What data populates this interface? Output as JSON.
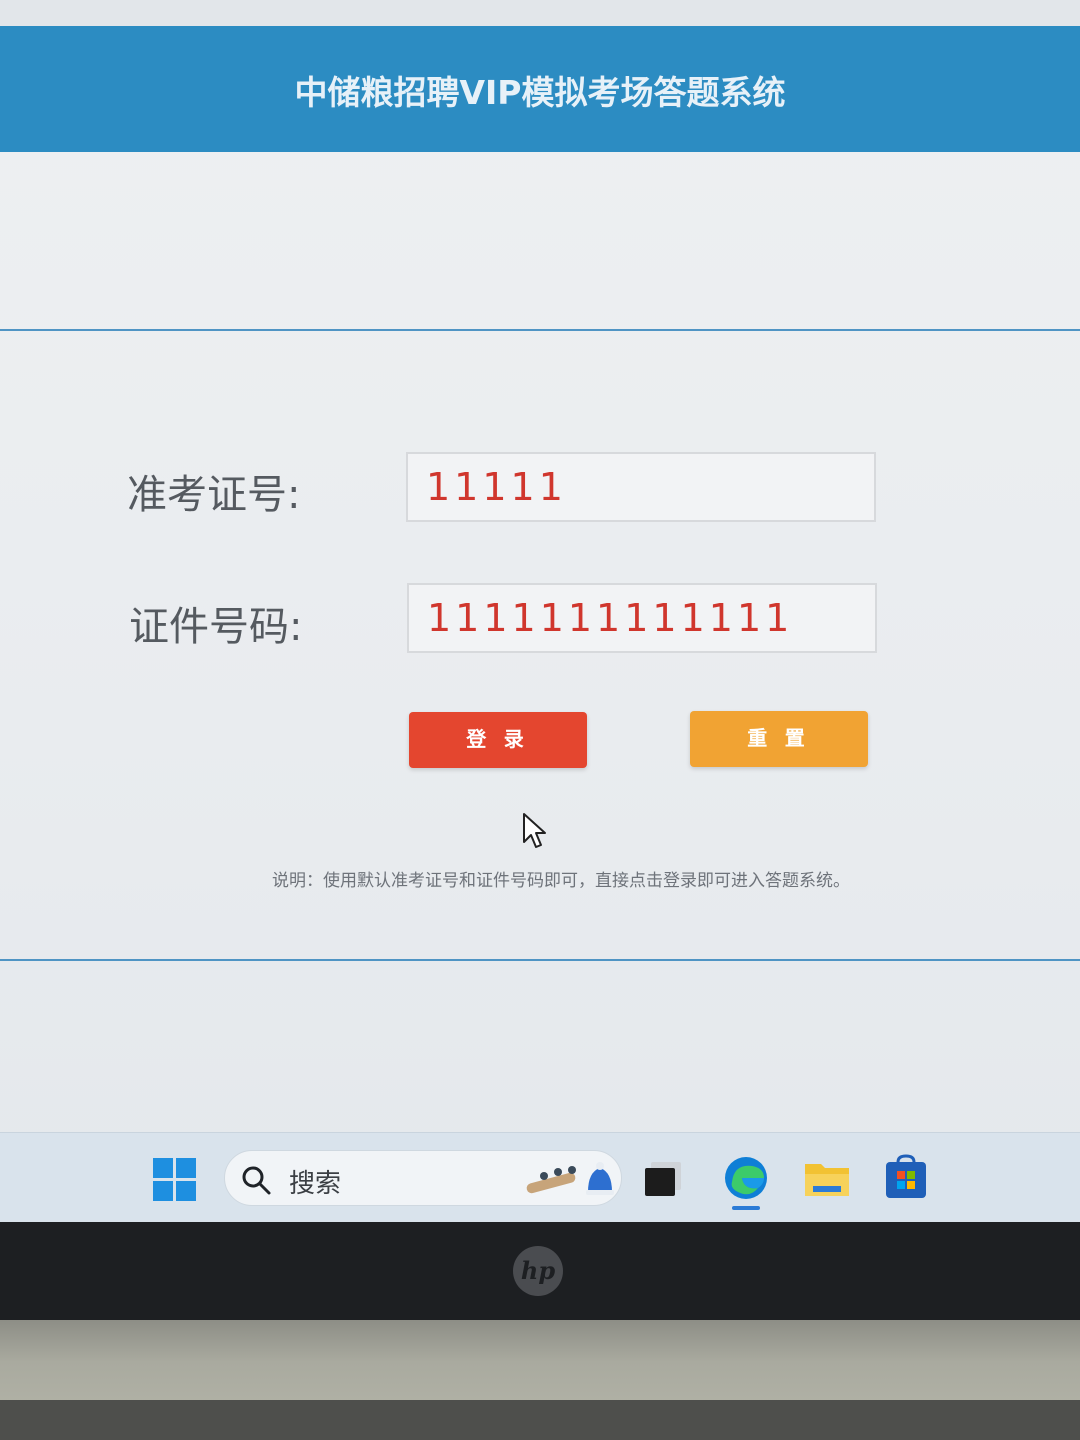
{
  "header": {
    "title": "中储粮招聘VIP模拟考场答题系统"
  },
  "form": {
    "exam_number": {
      "label": "准考证号:",
      "value": "11111"
    },
    "id_number": {
      "label": "证件号码:",
      "value": "1111111111111"
    },
    "login_label": "登 录",
    "reset_label": "重 置",
    "note": "说明：使用默认准考证号和证件号码即可，直接点击登录即可进入答题系统。"
  },
  "taskbar": {
    "search_placeholder": "搜索",
    "icons": [
      "windows-start-icon",
      "search-icon",
      "task-view-icon",
      "edge-icon",
      "file-explorer-icon",
      "store-icon"
    ],
    "accent": "#2b7bd6"
  },
  "colors": {
    "header_bg": "#2c8cc2",
    "input_text": "#d0362d",
    "login_button": "#e4462f",
    "reset_button": "#f1a333"
  },
  "device": {
    "logo": "hp"
  }
}
